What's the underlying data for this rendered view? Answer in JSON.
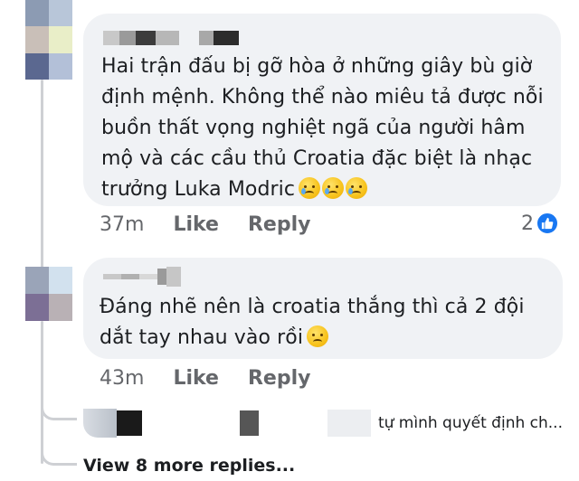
{
  "comments": [
    {
      "text": "Hai trận đấu bị gỡ hòa ở những giây bù giờ định mệnh. Không thể nào miêu tả được nỗi buồn thất vọng nghiệt ngã của người hâm mộ và các cầu thủ Croatia đặc biệt là nhạc trưởng Luka Modric",
      "emojis": [
        "crying-face-icon",
        "crying-face-icon",
        "crying-face-icon"
      ],
      "time": "37m",
      "like_label": "Like",
      "reply_label": "Reply",
      "reaction_count": "2",
      "reaction_icon": "thumbs-up-icon"
    },
    {
      "text": "Đáng nhẽ nên là croatia thắng thì cả 2 đội dắt tay nhau vào rồi",
      "emojis": [
        "pensive-face-icon"
      ],
      "time": "43m",
      "like_label": "Like",
      "reply_label": "Reply"
    }
  ],
  "reply_preview": {
    "text": "tự mình quyết định ch..."
  },
  "view_more": "View 8 more replies...",
  "colors": {
    "bubble": "#f0f2f5",
    "meta_text": "#65676b",
    "like_blue": "#1877f2",
    "thread_line": "#ced0d4"
  }
}
